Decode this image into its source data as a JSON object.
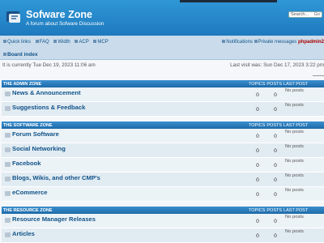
{
  "header": {
    "title": "Sofware Zone",
    "description": "A forum about Sofware Discussion",
    "search_placeholder": "Search...",
    "search_go": "Go"
  },
  "nav": {
    "quick_links": "Quick links",
    "faq": "FAQ",
    "width": "Width",
    "acp": "ACP",
    "mcp": "MCP",
    "notifications": "Notifications",
    "private_messages": "Private messages",
    "username": "phpadmin2",
    "board_index": "Board index"
  },
  "status": {
    "current_time": "It is currently Tue Dec 19, 2023 11:06 am",
    "last_visit": "Last visit was: Sun Dec 17, 2023 3:22 pm"
  },
  "columns": {
    "topics": "TOPICS",
    "posts": "POSTS",
    "last_post": "LAST POST"
  },
  "categories": [
    {
      "name": "THE ADMIN ZONE",
      "forums": [
        {
          "name": "News & Announcement",
          "topics": "0",
          "posts": "0",
          "last_post": "No posts"
        },
        {
          "name": "Suggestions & Feedback",
          "topics": "0",
          "posts": "0",
          "last_post": "No posts"
        }
      ]
    },
    {
      "name": "THE SOFTWARE ZONE",
      "forums": [
        {
          "name": "Forum Software",
          "topics": "0",
          "posts": "0",
          "last_post": "No posts"
        },
        {
          "name": "Social Networking",
          "topics": "0",
          "posts": "0",
          "last_post": "No posts"
        },
        {
          "name": "Facebook",
          "topics": "0",
          "posts": "0",
          "last_post": "No posts"
        },
        {
          "name": "Blogs, Wikis, and other CMP's",
          "topics": "0",
          "posts": "0",
          "last_post": "No posts"
        },
        {
          "name": "eCommerce",
          "topics": "0",
          "posts": "0",
          "last_post": "No posts"
        }
      ]
    },
    {
      "name": "THE RESOURCE ZONE",
      "forums": [
        {
          "name": "Resource Manager Releases",
          "topics": "0",
          "posts": "0",
          "last_post": "No posts"
        },
        {
          "name": "Articles",
          "topics": "0",
          "posts": "0",
          "last_post": "No posts"
        }
      ]
    }
  ]
}
